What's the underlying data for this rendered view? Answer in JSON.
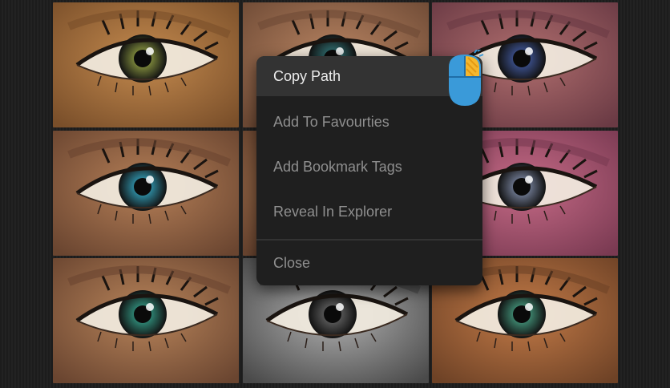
{
  "menu": {
    "items": [
      {
        "label": "Copy Path"
      },
      {
        "label": "Add To Favourties"
      },
      {
        "label": "Add Bookmark Tags"
      },
      {
        "label": "Reveal In Explorer"
      },
      {
        "label": "Close"
      }
    ],
    "active_index": 0
  },
  "grid": {
    "tiles": [
      {
        "skin": "#c48a4e",
        "iris": "#7f8a3c",
        "shade": "#7a4f2a"
      },
      {
        "skin": "#b88462",
        "iris": "#2f6a6c",
        "shade": "#6e4a35"
      },
      {
        "skin": "#b06e6e",
        "iris": "#3b4f8a",
        "shade": "#6a3a44"
      },
      {
        "skin": "#b57f57",
        "iris": "#2f8fa6",
        "shade": "#6a4530"
      },
      {
        "skin": "#b07d55",
        "iris": "#3f6e7a",
        "shade": "#6a4530"
      },
      {
        "skin": "#c56a86",
        "iris": "#6e7890",
        "shade": "#7a3a52"
      },
      {
        "skin": "#b8845a",
        "iris": "#2f8a78",
        "shade": "#6a4530"
      },
      {
        "skin": "#b0b0b0",
        "iris": "#5a5a5a",
        "shade": "#4a4a4a"
      },
      {
        "skin": "#c27a47",
        "iris": "#3f8a72",
        "shade": "#6e4226"
      }
    ]
  },
  "cursor": {
    "icon": "mouse-click-icon",
    "body_color": "#3a9ad9",
    "accent_color": "#f5b72e"
  }
}
